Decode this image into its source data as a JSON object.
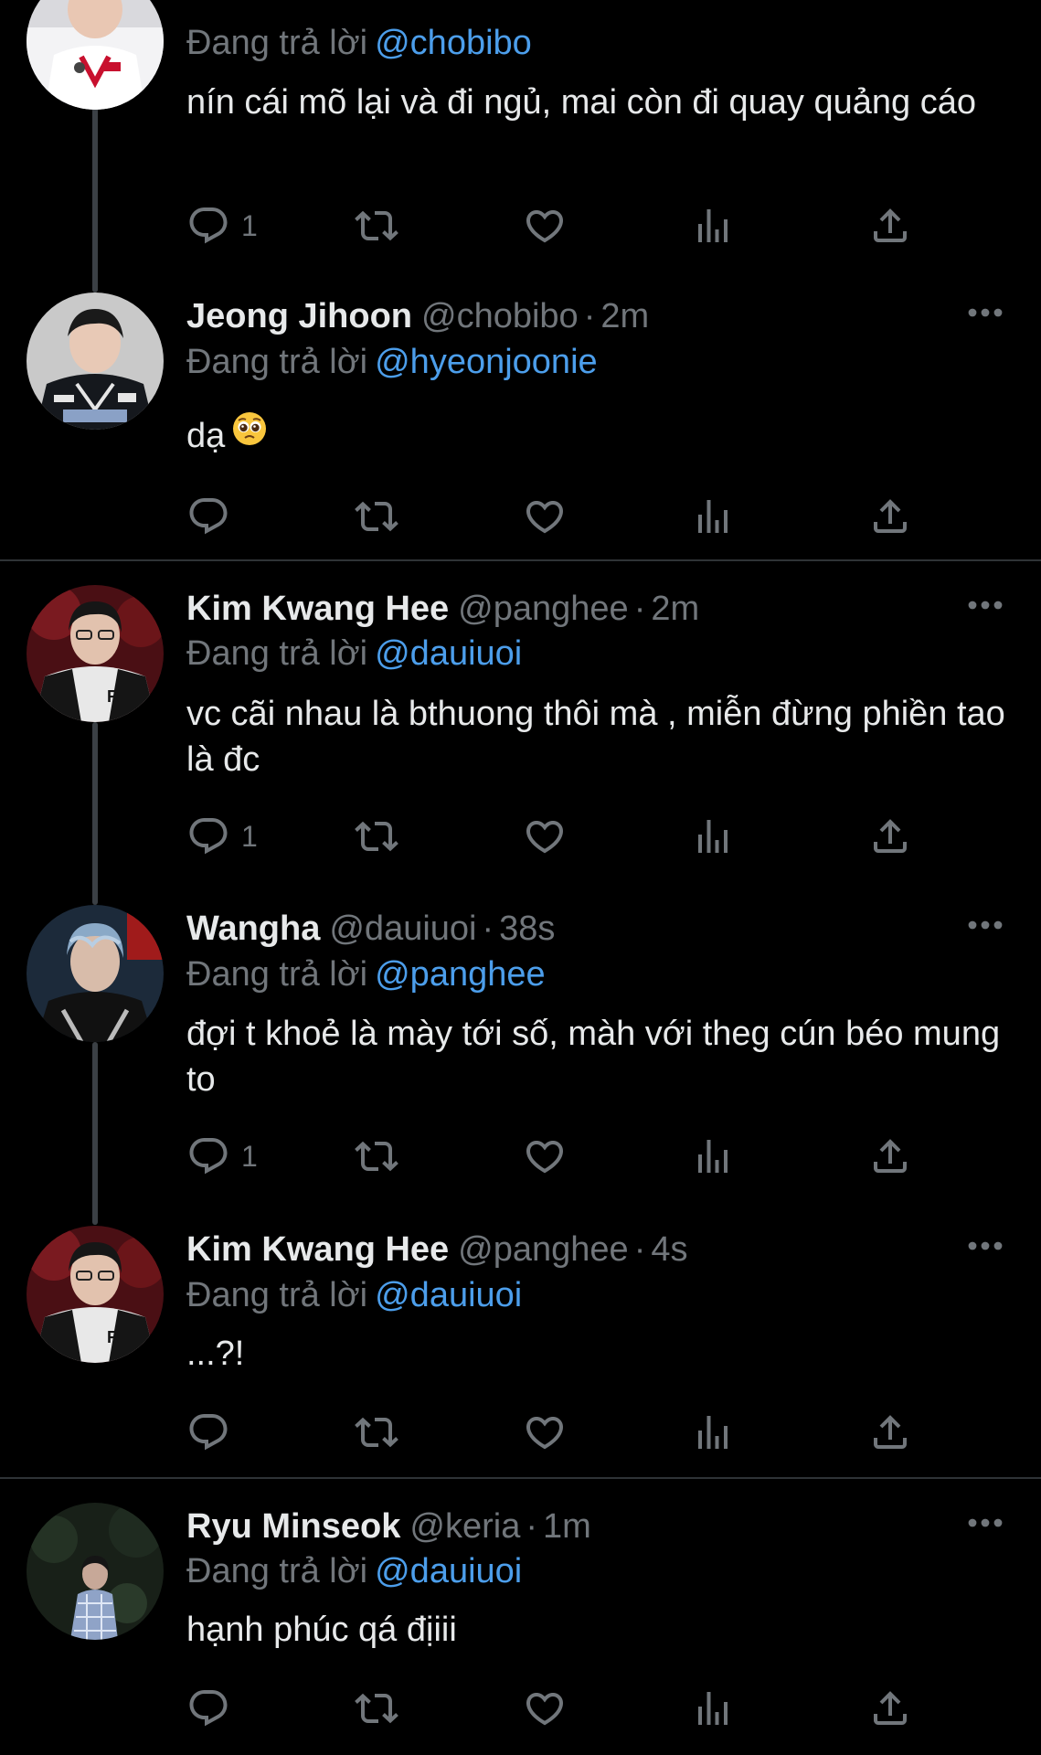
{
  "colors": {
    "background": "#000000",
    "text": "#e7e9ea",
    "muted": "#71767b",
    "mention": "#4c9eeb",
    "divider": "#2f3336",
    "thread_line": "#3b4045"
  },
  "icons": {
    "reply": "reply-icon",
    "retweet": "retweet-icon",
    "like": "like-icon",
    "views": "views-icon",
    "share": "share-icon",
    "more": "more-icon"
  },
  "tweets": [
    {
      "name": "",
      "handle": "",
      "time": "",
      "replying_label": "Đang trả lời",
      "replying_to": "@chobibo",
      "text": "nín cái mõ lại và đi ngủ, mai còn đi quay quảng cáo",
      "reply_count": "1"
    },
    {
      "name": "Jeong Jihoon",
      "handle": "@chobibo",
      "time": "2m",
      "replying_label": "Đang trả lời",
      "replying_to": "@hyeonjoonie",
      "text": "dạ",
      "emoji": "pleading-face",
      "reply_count": ""
    },
    {
      "name": "Kim Kwang Hee",
      "handle": "@panghee",
      "time": "2m",
      "replying_label": "Đang trả lời",
      "replying_to": "@dauiuoi",
      "text": "vc cãi nhau là bthuong thôi mà , miễn đừng phiền tao là đc",
      "reply_count": "1"
    },
    {
      "name": "Wangha",
      "handle": "@dauiuoi",
      "time": "38s",
      "replying_label": "Đang trả lời",
      "replying_to": "@panghee",
      "text": "đợi t khoẻ là mày tới số, màh với theg cún béo mung to",
      "reply_count": "1"
    },
    {
      "name": "Kim Kwang Hee",
      "handle": "@panghee",
      "time": "4s",
      "replying_label": "Đang trả lời",
      "replying_to": "@dauiuoi",
      "text": "...?!",
      "reply_count": ""
    },
    {
      "name": "Ryu Minseok",
      "handle": "@keria",
      "time": "1m",
      "replying_label": "Đang trả lời",
      "replying_to": "@dauiuoi",
      "text": "hạnh phúc qá địiii",
      "reply_count": ""
    }
  ]
}
